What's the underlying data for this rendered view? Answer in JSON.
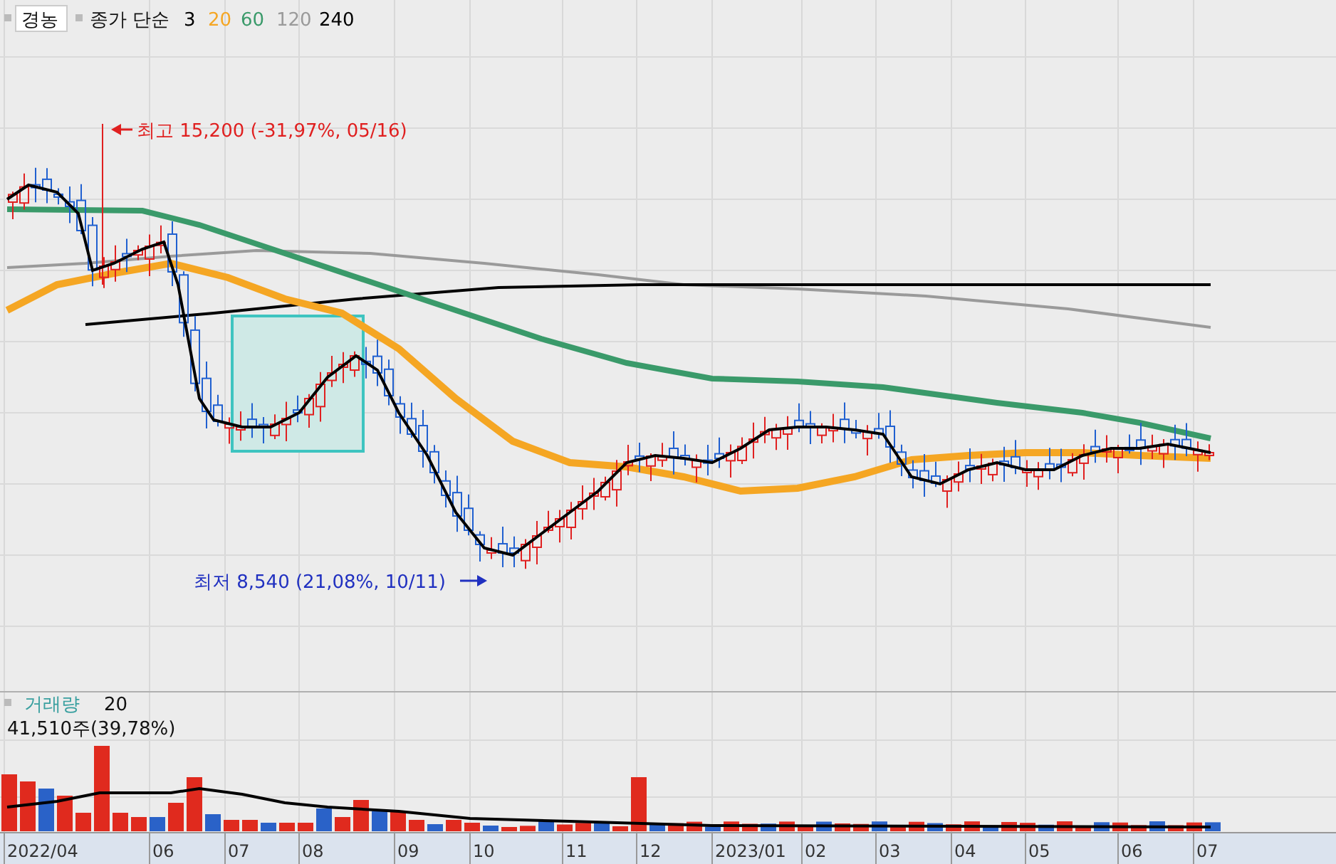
{
  "header": {
    "stock": "경농",
    "indicator": "종가 단순",
    "ma_periods": [
      {
        "label": "3",
        "color": "#000000"
      },
      {
        "label": "20",
        "color": "#f5a623"
      },
      {
        "label": "60",
        "color": "#3a9a6a"
      },
      {
        "label": "120",
        "color": "#9a9a9a"
      },
      {
        "label": "240",
        "color": "#000000"
      }
    ]
  },
  "annotations": {
    "high": "최고 15,200 (-31,97%, 05/16)",
    "low": "최저 8,540 (21,08%, 10/11)"
  },
  "volume": {
    "title": "거래량",
    "period": "20",
    "reading": "41,510주(39,78%)"
  },
  "x_axis": [
    "2022/04",
    "06",
    "07",
    "08",
    "09",
    "10",
    "11",
    "12",
    "2023/01",
    "02",
    "03",
    "04",
    "05",
    "06",
    "07"
  ]
}
